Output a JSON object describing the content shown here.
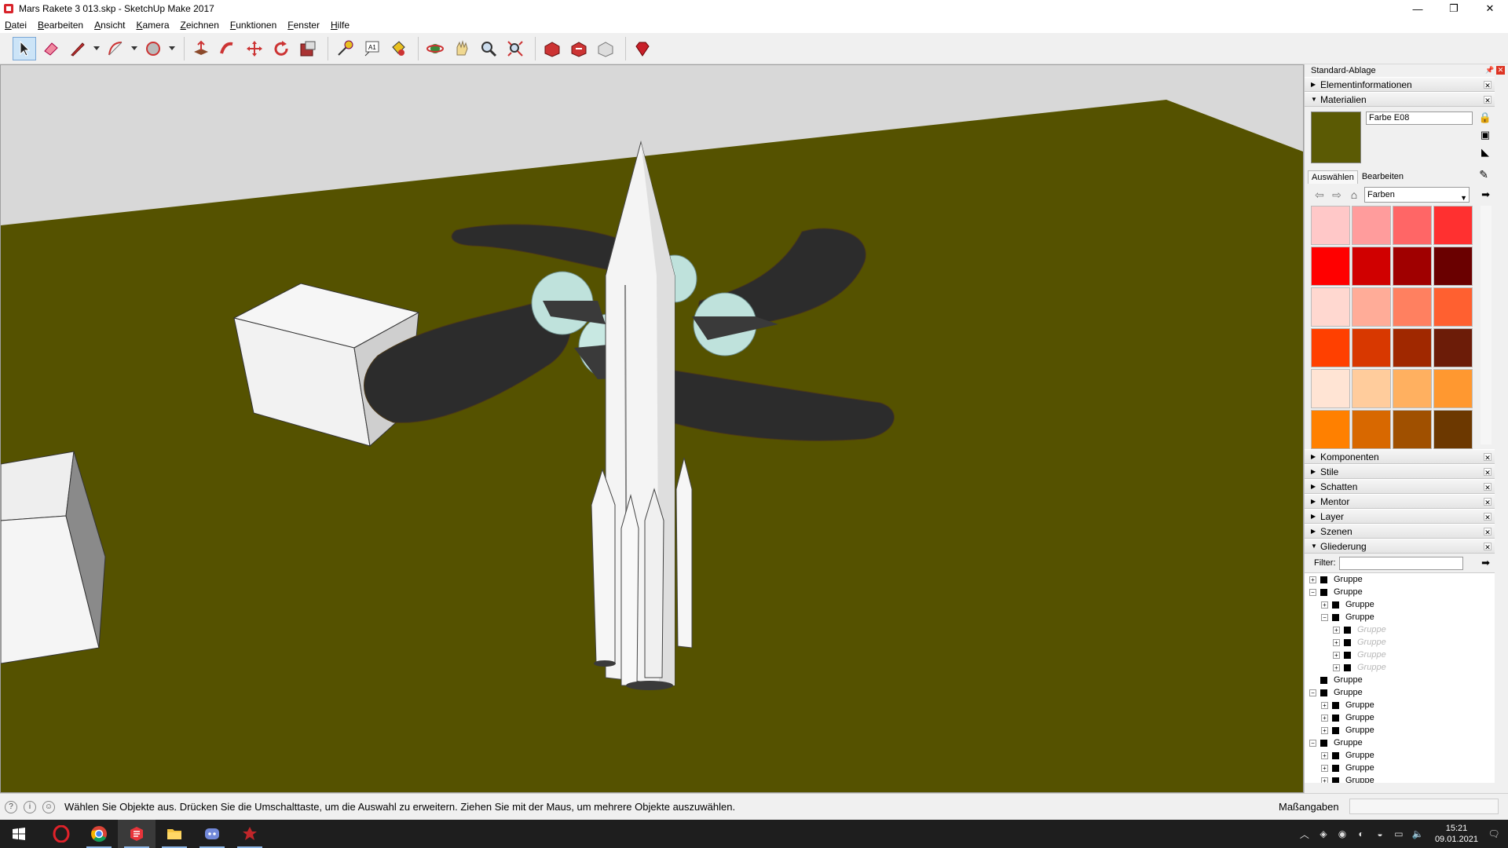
{
  "window": {
    "title": "Mars Rakete 3 013.skp - SketchUp Make 2017",
    "minimize_glyph": "—",
    "maximize_glyph": "❐",
    "close_glyph": "✕"
  },
  "menu": [
    "Datei",
    "Bearbeiten",
    "Ansicht",
    "Kamera",
    "Zeichnen",
    "Funktionen",
    "Fenster",
    "Hilfe"
  ],
  "toolbar": {
    "tools": [
      "select-icon",
      "eraser-icon",
      "pencil-line-icon",
      "arc-icon",
      "circle-icon",
      "push-pull-icon",
      "follow-me-icon",
      "move-icon",
      "rotate-icon",
      "scale-icon",
      "tape-measure-icon",
      "text-icon",
      "paint-bucket-icon",
      "orbit-icon",
      "pan-icon",
      "zoom-icon",
      "zoom-extents-icon",
      "warehouse-icon",
      "share-model-icon",
      "extension-warehouse-icon",
      "ruby-icon"
    ]
  },
  "tray": {
    "title": "Standard-Ablage",
    "panels_top": [
      {
        "label": "Elementinformationen",
        "expanded": false
      },
      {
        "label": "Materialien",
        "expanded": true
      }
    ],
    "materials": {
      "name": "Farbe E08",
      "current_color": "#5b5a04",
      "tabs": [
        "Auswählen",
        "Bearbeiten"
      ],
      "active_tab": "Auswählen",
      "library": "Farben",
      "swatches": [
        "#ffc8c8",
        "#ff9c9c",
        "#ff6666",
        "#ff3030",
        "#ff0000",
        "#d00000",
        "#a00000",
        "#6a0000",
        "#ffd8d0",
        "#ffac98",
        "#ff8060",
        "#ff6030",
        "#ff4000",
        "#d83800",
        "#a02800",
        "#6c1c08",
        "#ffe4d4",
        "#ffcc9c",
        "#ffb060",
        "#ff9830",
        "#ff8000",
        "#d86800",
        "#a05000",
        "#6c3800"
      ]
    },
    "panels_bottom": [
      {
        "label": "Komponenten",
        "expanded": false
      },
      {
        "label": "Stile",
        "expanded": false
      },
      {
        "label": "Schatten",
        "expanded": false
      },
      {
        "label": "Mentor",
        "expanded": false
      },
      {
        "label": "Layer",
        "expanded": false
      },
      {
        "label": "Szenen",
        "expanded": false
      },
      {
        "label": "Gliederung",
        "expanded": true
      }
    ],
    "outliner": {
      "filter_label": "Filter:",
      "rows": [
        {
          "depth": 0,
          "exp": "+",
          "label": "Gruppe",
          "dim": false
        },
        {
          "depth": 0,
          "exp": "−",
          "label": "Gruppe",
          "dim": false
        },
        {
          "depth": 1,
          "exp": "+",
          "label": "Gruppe",
          "dim": false
        },
        {
          "depth": 1,
          "exp": "−",
          "label": "Gruppe",
          "dim": false
        },
        {
          "depth": 2,
          "exp": "+",
          "label": "Gruppe",
          "dim": true
        },
        {
          "depth": 2,
          "exp": "+",
          "label": "Gruppe",
          "dim": true
        },
        {
          "depth": 2,
          "exp": "+",
          "label": "Gruppe",
          "dim": true
        },
        {
          "depth": 2,
          "exp": "+",
          "label": "Gruppe",
          "dim": true
        },
        {
          "depth": 0,
          "exp": "",
          "label": "Gruppe",
          "dim": false
        },
        {
          "depth": 0,
          "exp": "−",
          "label": "Gruppe",
          "dim": false
        },
        {
          "depth": 1,
          "exp": "+",
          "label": "Gruppe",
          "dim": false
        },
        {
          "depth": 1,
          "exp": "+",
          "label": "Gruppe",
          "dim": false
        },
        {
          "depth": 1,
          "exp": "+",
          "label": "Gruppe",
          "dim": false
        },
        {
          "depth": 0,
          "exp": "−",
          "label": "Gruppe",
          "dim": false
        },
        {
          "depth": 1,
          "exp": "+",
          "label": "Gruppe",
          "dim": false
        },
        {
          "depth": 1,
          "exp": "+",
          "label": "Gruppe",
          "dim": false
        },
        {
          "depth": 1,
          "exp": "+",
          "label": "Gruppe",
          "dim": false
        }
      ]
    }
  },
  "status": {
    "text": "Wählen Sie Objekte aus. Drücken Sie die Umschalttaste, um die Auswahl zu erweitern. Ziehen Sie mit der Maus, um mehrere Objekte auszuwählen.",
    "measure_label": "Maßangaben",
    "measure_value": ""
  },
  "taskbar": {
    "apps": [
      "windows-start-icon",
      "opera-icon",
      "chrome-icon",
      "sketchup-icon",
      "file-explorer-icon",
      "discord-icon",
      "game-app-icon"
    ],
    "time": "15:21",
    "date": "09.01.2021"
  },
  "colors": {
    "ground": "#555200",
    "sky": "#d8d8d8",
    "wing": "#2c2c2c"
  }
}
